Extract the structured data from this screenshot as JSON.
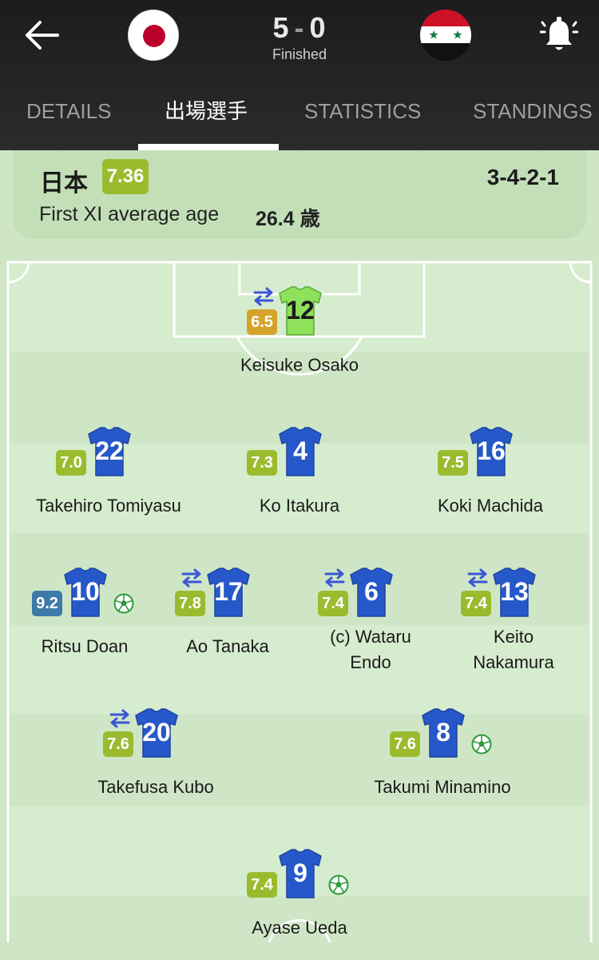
{
  "header": {
    "score_home": "5",
    "score_sep": "-",
    "score_away": "0",
    "status": "Finished",
    "home_flag": "japan-flag",
    "away_flag": "syria-flag"
  },
  "tabs": [
    {
      "label": "DETAILS",
      "active": false
    },
    {
      "label": "出場選手",
      "active": true
    },
    {
      "label": "STATISTICS",
      "active": false
    },
    {
      "label": "STANDINGS",
      "active": false
    }
  ],
  "team": {
    "name": "日本",
    "rating": "7.36",
    "formation": "3-4-2-1",
    "avg_age_label": "First XI average age",
    "avg_age_value": "26.4 歳"
  },
  "colors": {
    "rating_green": "#9bbb2f",
    "rating_gold": "#d5a22a",
    "rating_blue": "#3d7aa8",
    "shirt_blue": "#2758c9",
    "keeper_green": "#8fe05a",
    "sub_icon": "#3b56d6"
  },
  "players": [
    {
      "number": "12",
      "name": "Keisuke Osako",
      "rating": "6.5",
      "rating_tier": "gold",
      "sub": true,
      "goal": false,
      "keeper": true
    },
    {
      "number": "22",
      "name": "Takehiro Tomiyasu",
      "rating": "7.0",
      "rating_tier": "green",
      "sub": false,
      "goal": false,
      "keeper": false
    },
    {
      "number": "4",
      "name": "Ko Itakura",
      "rating": "7.3",
      "rating_tier": "green",
      "sub": false,
      "goal": false,
      "keeper": false
    },
    {
      "number": "16",
      "name": "Koki Machida",
      "rating": "7.5",
      "rating_tier": "green",
      "sub": false,
      "goal": false,
      "keeper": false
    },
    {
      "number": "10",
      "name": "Ritsu Doan",
      "rating": "9.2",
      "rating_tier": "blue",
      "sub": false,
      "goal": true,
      "keeper": false
    },
    {
      "number": "17",
      "name": "Ao Tanaka",
      "rating": "7.8",
      "rating_tier": "green",
      "sub": true,
      "goal": false,
      "keeper": false
    },
    {
      "number": "6",
      "name": "(c) Wataru Endo",
      "rating": "7.4",
      "rating_tier": "green",
      "sub": true,
      "goal": false,
      "keeper": false
    },
    {
      "number": "13",
      "name": "Keito Nakamura",
      "rating": "7.4",
      "rating_tier": "green",
      "sub": true,
      "goal": false,
      "keeper": false
    },
    {
      "number": "20",
      "name": "Takefusa Kubo",
      "rating": "7.6",
      "rating_tier": "green",
      "sub": true,
      "goal": false,
      "keeper": false
    },
    {
      "number": "8",
      "name": "Takumi Minamino",
      "rating": "7.6",
      "rating_tier": "green",
      "sub": false,
      "goal": true,
      "keeper": false
    },
    {
      "number": "9",
      "name": "Ayase Ueda",
      "rating": "7.4",
      "rating_tier": "green",
      "sub": false,
      "goal": true,
      "keeper": false
    }
  ]
}
